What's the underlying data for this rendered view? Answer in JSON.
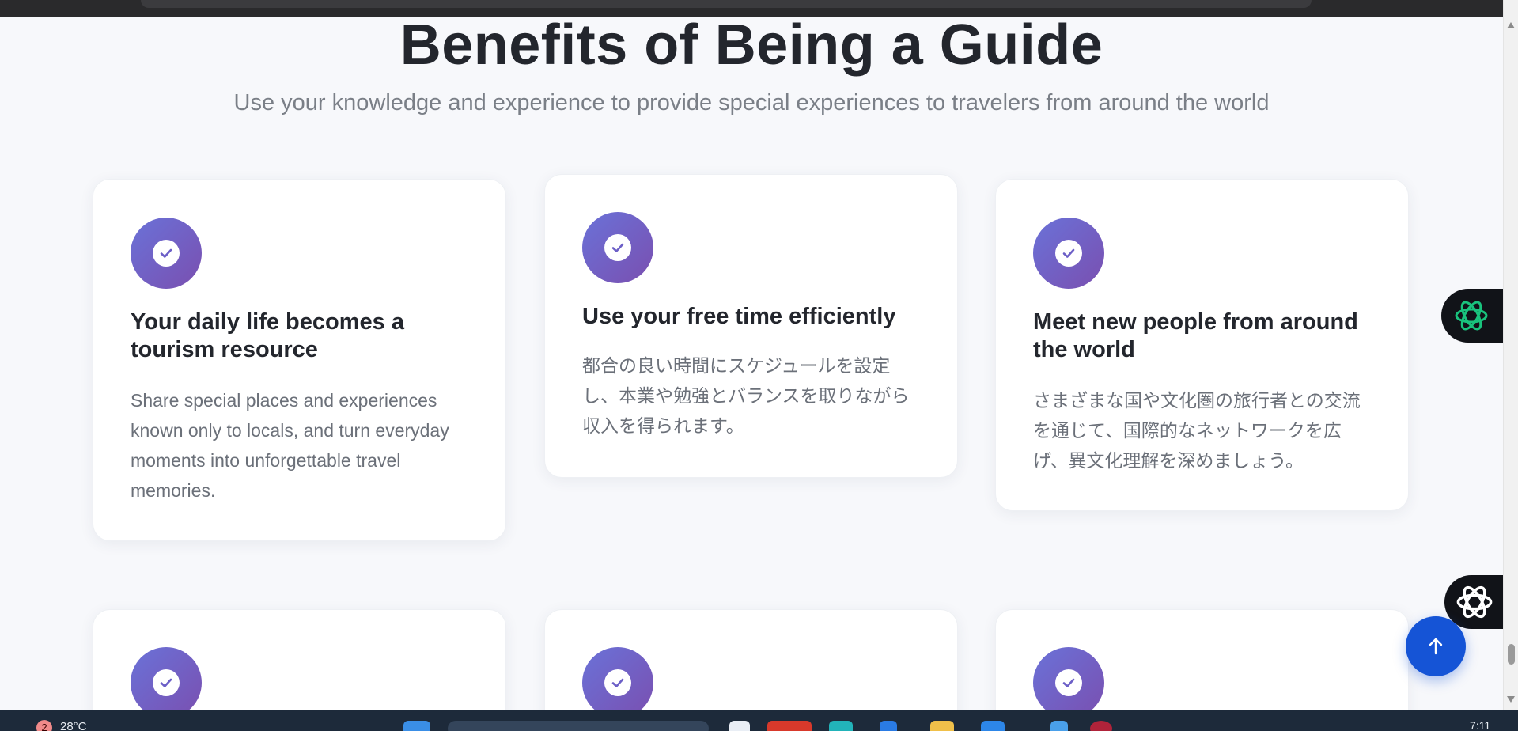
{
  "section": {
    "title": "Benefits of Being a Guide",
    "subtitle": "Use your knowledge and experience to provide special experiences to travelers from around the world"
  },
  "cards": [
    {
      "title": "Your daily life becomes a tourism resource",
      "description": "Share special places and experiences known only to locals, and turn everyday moments into unforgettable travel memories.",
      "icon": "check-circle-icon"
    },
    {
      "title": "Use your free time efficiently",
      "description": "都合の良い時間にスケジュールを設定し、本業や勉強とバランスを取りながら収入を得られます。",
      "icon": "check-circle-icon"
    },
    {
      "title": "Meet new people from around the world",
      "description": "さまざまな国や文化圏の旅行者との交流を通じて、国際的なネットワークを広げ、異文化理解を深めましょう。",
      "icon": "check-circle-icon"
    },
    {
      "icon": "check-circle-icon"
    },
    {
      "icon": "check-circle-icon"
    },
    {
      "icon": "check-circle-icon"
    }
  ],
  "widgets": {
    "ai_assistant_green_icon": "openai-logo-icon",
    "ai_assistant_white_icon": "openai-logo-icon",
    "scroll_top_icon": "arrow-up-icon"
  },
  "taskbar": {
    "weather_badge": "2",
    "temperature": "28°C",
    "clock": "7:11"
  },
  "colors": {
    "accent_gradient_start": "#6a72d8",
    "accent_gradient_end": "#7a4fb0",
    "scroll_top_button": "#1554d6",
    "page_background": "#f7f8fb"
  }
}
